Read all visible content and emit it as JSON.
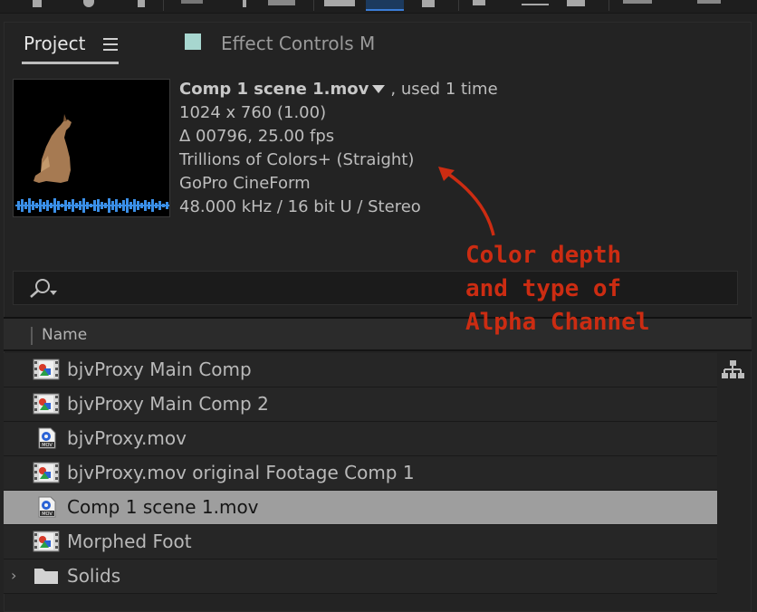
{
  "toolbar": {
    "icons": [
      "selection-tool",
      "hand-tool",
      "zoom-tool",
      "rotate-tool",
      "camera-tool",
      "pan-behind-tool",
      "rectangle-tool",
      "pen-tool",
      "text-tool",
      "brush-tool",
      "clone-tool",
      "eraser-tool",
      "roto-tool",
      "puppet-tool"
    ]
  },
  "tabs": {
    "project": "Project",
    "effect_controls": "Effect Controls M",
    "effect_swatch_color": "#a7d6cf"
  },
  "footage": {
    "name": "Comp 1 scene 1.mov",
    "used": ", used 1 time",
    "dimensions": "1024 x 760 (1.00)",
    "duration_fps": "Δ 00796, 25.00 fps",
    "color_depth": "Trillions of Colors+ (Straight)",
    "codec": "GoPro CineForm",
    "audio": "48.000 kHz / 16 bit U / Stereo"
  },
  "search": {
    "icon": "search-icon"
  },
  "columns": {
    "name": "Name"
  },
  "items": [
    {
      "label": "bjvProxy Main Comp",
      "type": "composition"
    },
    {
      "label": "bjvProxy Main Comp 2",
      "type": "composition"
    },
    {
      "label": "bjvProxy.mov",
      "type": "movie"
    },
    {
      "label": "bjvProxy.mov original Footage Comp 1",
      "type": "composition"
    },
    {
      "label": "Comp 1 scene 1.mov",
      "type": "movie",
      "selected": true
    },
    {
      "label": "Morphed Foot",
      "type": "composition"
    },
    {
      "label": "Solids",
      "type": "folder"
    }
  ],
  "annotation": {
    "line1": "Color depth",
    "line2": "and type of",
    "line3": "Alpha Channel",
    "color": "#cc2c12"
  },
  "colors": {
    "panel_bg": "#232323",
    "selected_row": "#9e9e9e",
    "audio_wave": "#3a8fe8"
  }
}
